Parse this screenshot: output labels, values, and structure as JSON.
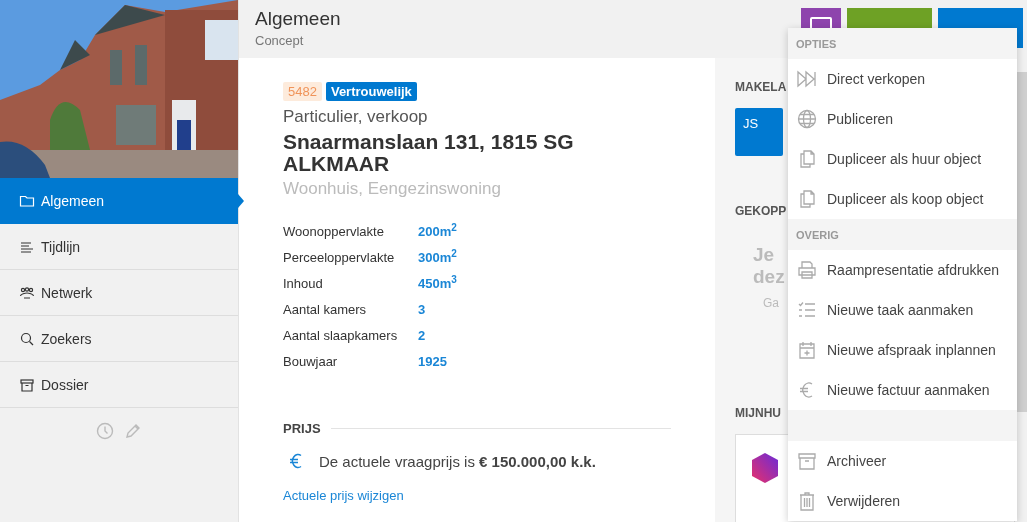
{
  "sidebar": {
    "items": [
      {
        "label": "Algemeen",
        "selected": true
      },
      {
        "label": "Tijdlijn",
        "selected": false
      },
      {
        "label": "Netwerk",
        "selected": false
      },
      {
        "label": "Zoekers",
        "selected": false
      },
      {
        "label": "Dossier",
        "selected": false
      }
    ]
  },
  "header": {
    "title": "Algemeen",
    "subtitle": "Concept",
    "buttons": [
      {
        "kind": "icon",
        "color": "#8e44ad"
      },
      {
        "kind": "plain",
        "color": "#6ea125"
      },
      {
        "kind": "plain",
        "color": "#0079d0"
      }
    ]
  },
  "property": {
    "badges": [
      {
        "kind": "id",
        "text": "5482"
      },
      {
        "kind": "tag",
        "text": "Vertrouwelijk"
      }
    ],
    "category": "Particulier, verkoop",
    "address": "Snaarmanslaan 131, 1815 SG ALKMAAR",
    "type": "Woonhuis, Eengezinswoning",
    "specs": [
      {
        "label": "Woonoppervlakte",
        "value": "200m$^{2}$"
      },
      {
        "label": "Perceeloppervlakte",
        "value": "300m$^{2}$"
      },
      {
        "label": "Inhoud",
        "value": "450m$^{3}$"
      },
      {
        "label": "Aantal kamers",
        "value": "3"
      },
      {
        "label": "Aantal slaapkamers",
        "value": "2"
      },
      {
        "label": "Bouwjaar",
        "value": "1925"
      }
    ],
    "price": {
      "heading": "PRIJS",
      "text": "De actuele vraagprijs is **€ 150.000,00 k.k.**",
      "link": "Actuele prijs wijzigen"
    }
  },
  "right_panel": {
    "makelaar": {
      "heading": "MAKELA",
      "initials": "JS"
    },
    "linked": {
      "heading": "GEKOPP",
      "line_1": "Je",
      "line_2": "dez",
      "hint": "Ga"
    },
    "mijnhuis": {
      "heading": "MIJNHU"
    }
  },
  "menu": {
    "sections": [
      {
        "heading": "OPTIES",
        "items": [
          {
            "label": "Direct verkopen"
          },
          {
            "label": "Publiceren"
          },
          {
            "label": "Dupliceer als huur object"
          },
          {
            "label": "Dupliceer als koop object"
          }
        ]
      },
      {
        "heading": "OVERIG",
        "items": [
          {
            "label": "Raampresentatie afdrukken"
          },
          {
            "label": "Nieuwe taak aanmaken"
          },
          {
            "label": "Nieuwe afspraak inplannen"
          },
          {
            "label": "Nieuwe factuur aanmaken"
          }
        ]
      },
      {
        "items": [
          {
            "label": "Archiveer"
          },
          {
            "label": "Verwijderen"
          }
        ]
      }
    ]
  }
}
